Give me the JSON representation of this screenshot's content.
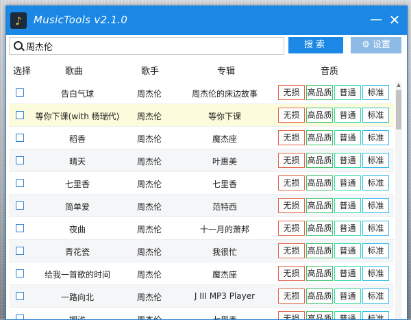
{
  "window": {
    "title": "MusicTools v2.1.0",
    "minimize": "—",
    "close": "✕"
  },
  "search": {
    "value": "周杰伦",
    "placeholder": "",
    "button": "搜索",
    "settings": "设置"
  },
  "columns": {
    "select": "选择",
    "song": "歌曲",
    "singer": "歌手",
    "album": "专辑",
    "quality": "音质"
  },
  "quality_labels": [
    "无损",
    "高品质",
    "普通",
    "标准"
  ],
  "rows": [
    {
      "song": "告白气球",
      "singer": "周杰伦",
      "album": "周杰伦的床边故事"
    },
    {
      "song": "等你下课(with 杨瑞代)",
      "singer": "周杰伦",
      "album": "等你下课"
    },
    {
      "song": "稻香",
      "singer": "周杰伦",
      "album": "魔杰座"
    },
    {
      "song": "晴天",
      "singer": "周杰伦",
      "album": "叶惠美"
    },
    {
      "song": "七里香",
      "singer": "周杰伦",
      "album": "七里香"
    },
    {
      "song": "简单爱",
      "singer": "周杰伦",
      "album": "范特西"
    },
    {
      "song": "夜曲",
      "singer": "周杰伦",
      "album": "十一月的萧邦"
    },
    {
      "song": "青花瓷",
      "singer": "周杰伦",
      "album": "我很忙"
    },
    {
      "song": "给我一首歌的时间",
      "singer": "周杰伦",
      "album": "魔杰座"
    },
    {
      "song": "一路向北",
      "singer": "周杰伦",
      "album": "J III MP3 Player"
    },
    {
      "song": "搁浅",
      "singer": "周杰伦",
      "album": "七里香"
    }
  ],
  "colors": {
    "accent": "#1a88e4",
    "highlight_row": "#fcfbdb",
    "lossless": "#e0664a",
    "hq": "#44c06a",
    "normal": "#2ed6a8",
    "standard": "#2db8e8"
  }
}
